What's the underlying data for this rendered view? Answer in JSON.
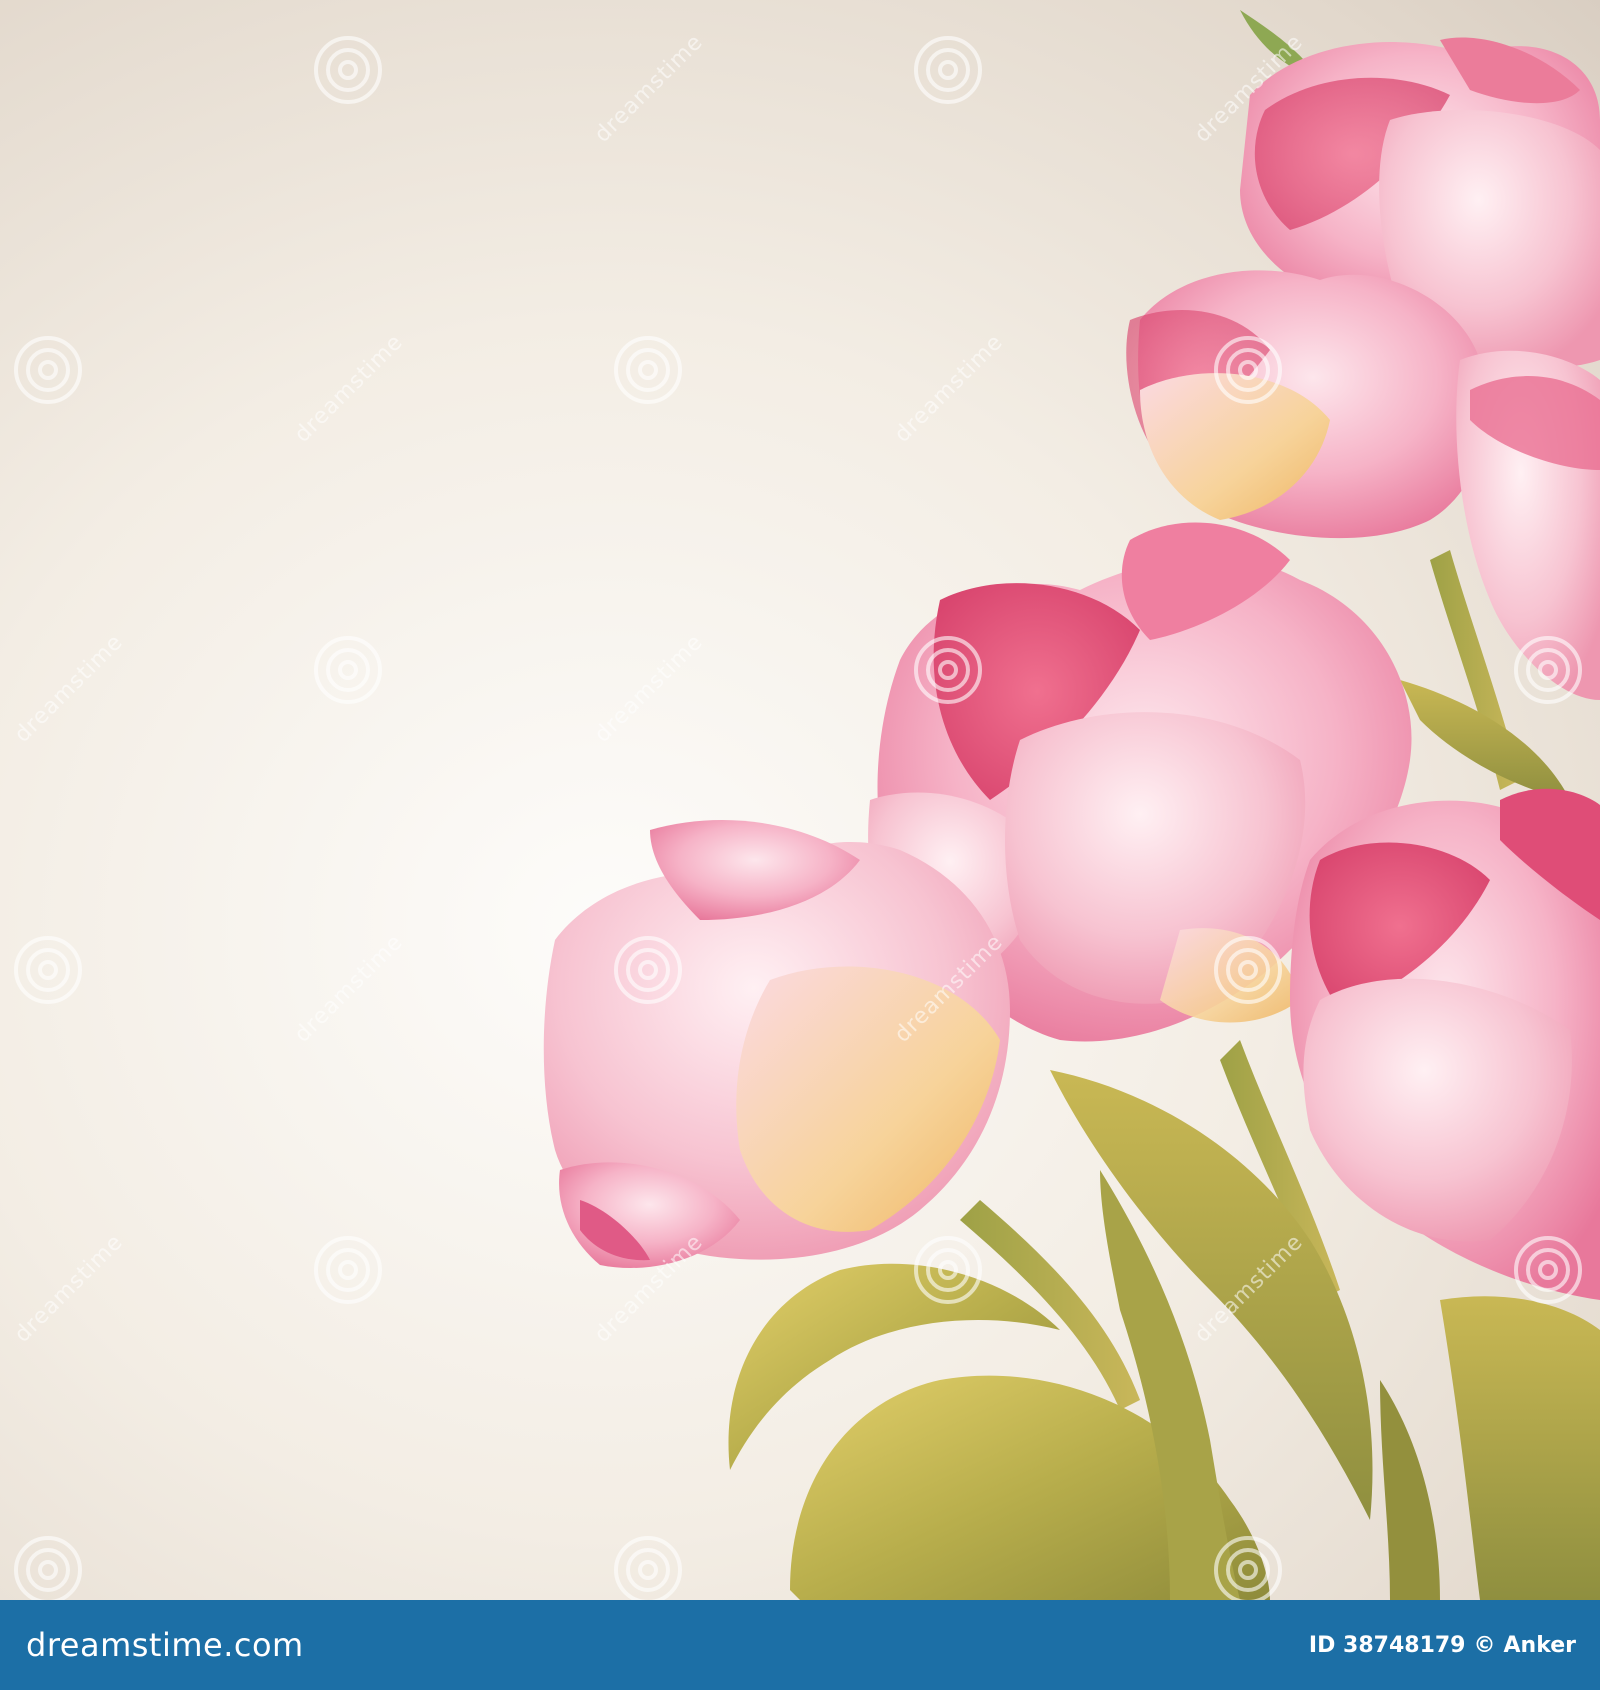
{
  "scene": {
    "subject": "pink-tulips-bouquet",
    "colors": {
      "background_light": "#fdfcfa",
      "background_dark": "#c9bdb1",
      "petal_light": "#f8c9d6",
      "petal_mid": "#f19ab4",
      "petal_deep": "#e35a83",
      "petal_yellow": "#f6d38a",
      "leaf_green": "#a2a146",
      "leaf_yellow": "#d6c25a",
      "footer_blue": "#1c6fa6"
    }
  },
  "watermark": {
    "diagonal_text": "dreamstime"
  },
  "footer": {
    "logo_text": "dreamstime.com",
    "id_label": "ID 38748179",
    "separator": "©",
    "author": "Anker"
  }
}
